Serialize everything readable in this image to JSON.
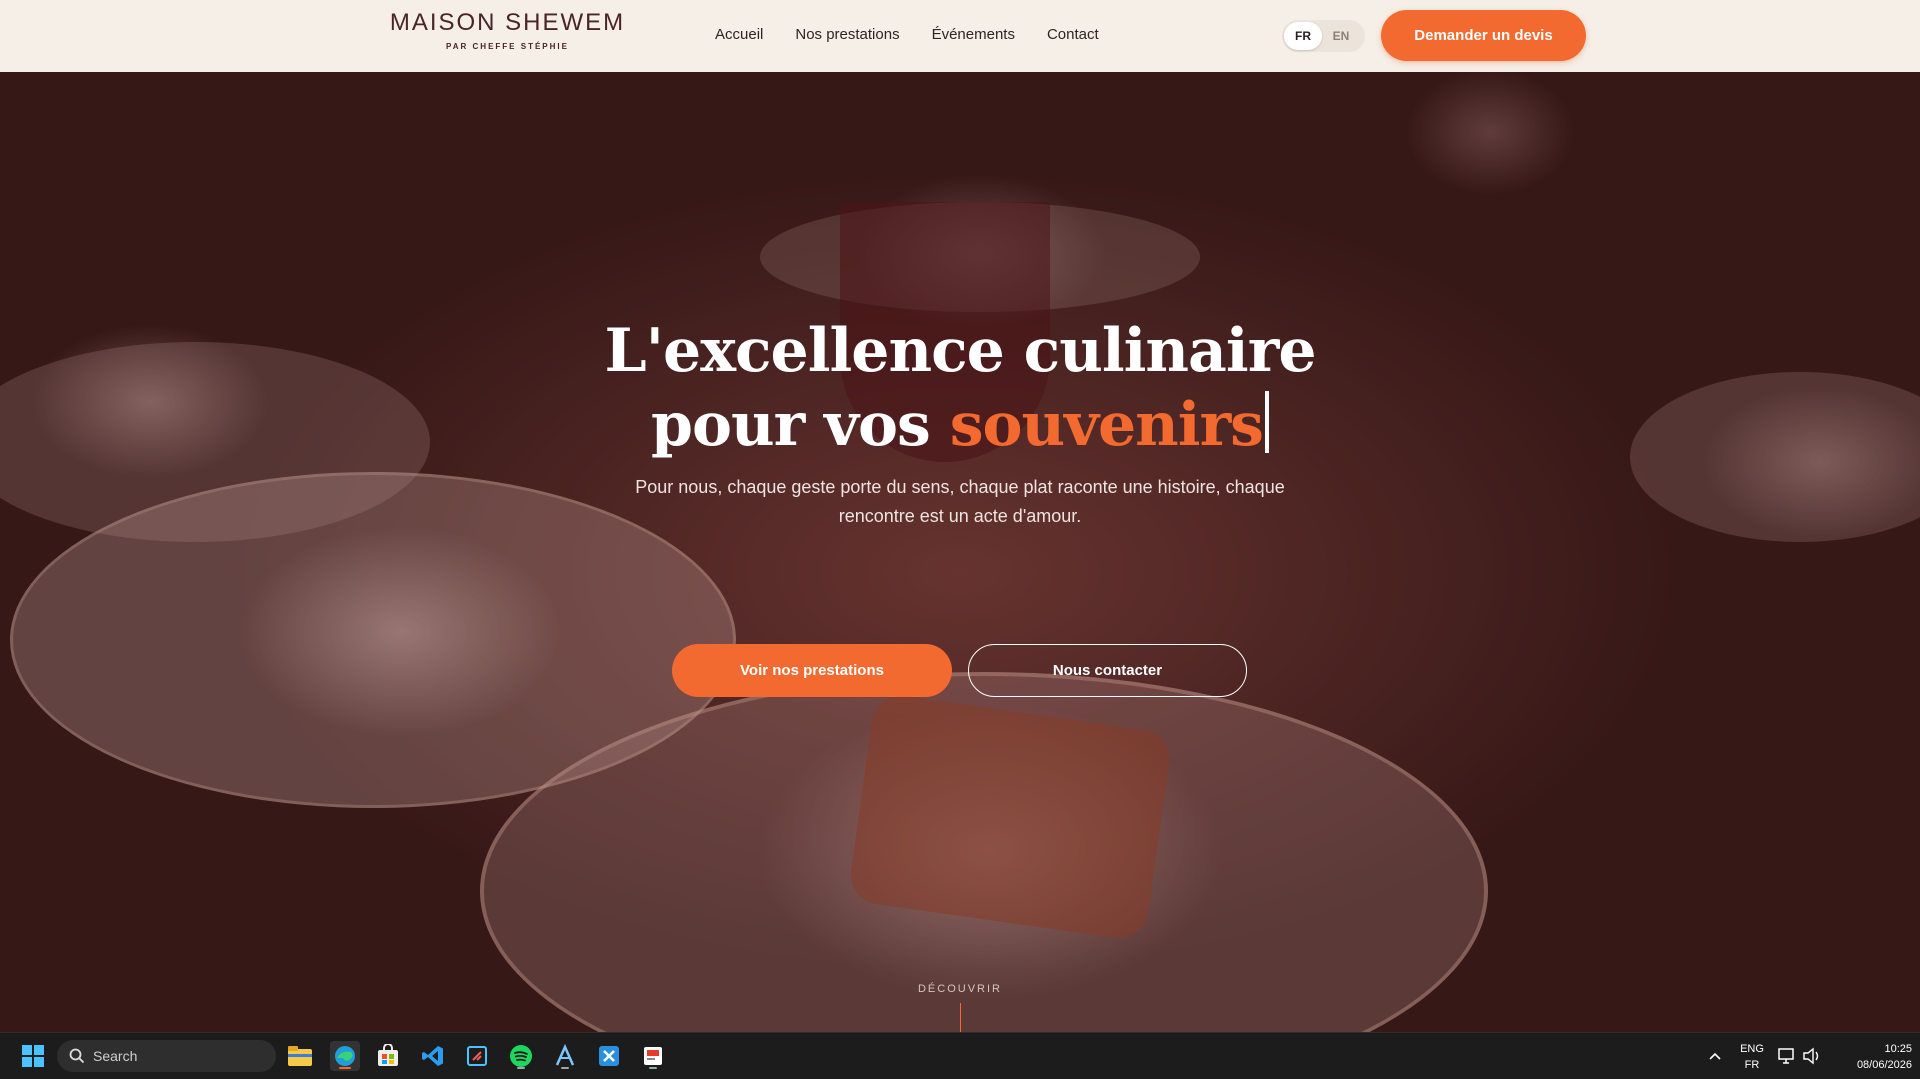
{
  "header": {
    "logo_main": "MAISON SHEWEM",
    "logo_sub": "PAR CHEFFE STÉPHIE",
    "nav": [
      "Accueil",
      "Nos prestations",
      "Événements",
      "Contact"
    ],
    "lang": {
      "fr": "FR",
      "en": "EN",
      "active": "FR"
    },
    "cta_label": "Demander un devis"
  },
  "hero": {
    "title_line1": "L'excellence culinaire",
    "title_line2_prefix": "pour vos",
    "title_line2_accent": "souvenirs",
    "subtitle": "Pour nous, chaque geste porte du sens, chaque plat raconte une histoire, chaque rencontre est un acte d'amour.",
    "primary_button": "Voir nos prestations",
    "secondary_button": "Nous contacter",
    "scroll_label": "DÉCOUVRIR"
  },
  "taskbar": {
    "search_placeholder": "Search",
    "apps": [
      "start-icon",
      "file-explorer-icon",
      "edge-icon",
      "store-icon",
      "vscode-icon",
      "snipping-tool-icon",
      "spotify-icon",
      "app-a-icon",
      "app-x-icon",
      "app-red-icon"
    ],
    "lang_top": "ENG",
    "lang_bottom": "FR",
    "time": "10:25",
    "date": "08/06/2026"
  },
  "colors": {
    "accent": "#f36a30",
    "header_bg": "#f5efe8",
    "logo": "#4a2427",
    "taskbar": "#1c1c1c"
  }
}
